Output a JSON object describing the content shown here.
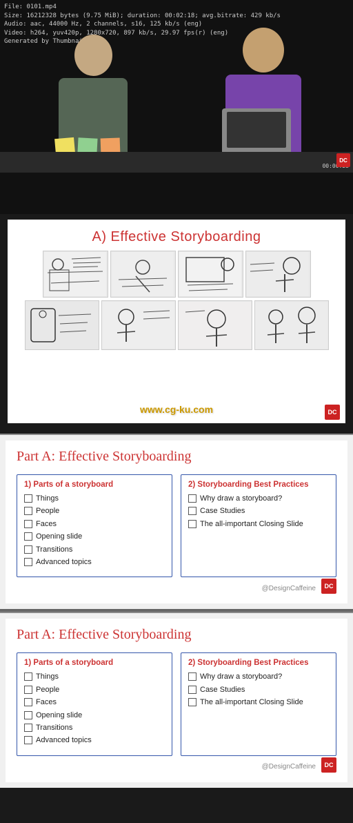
{
  "video": {
    "metadata_line1": "File: 0101.mp4",
    "metadata_line2": "Size: 16212328 bytes (9.75 MiB); duration: 00:02:18; avg.bitrate: 429 kb/s",
    "metadata_line3": "Audio: aac, 44000 Hz, 2 channels, s16, 125 kb/s (eng)",
    "metadata_line4": "Video: h264, yuv420p, 1280x720, 897 kb/s, 29.97 fps(r) (eng)",
    "metadata_line5": "Generated by Thumbnail me",
    "timestamp": "00:00:28",
    "apple_logo": ""
  },
  "slide1": {
    "title": "A) Effective Storyboarding",
    "watermark": "www.cg-ku.com",
    "dce_label": "DC"
  },
  "outline1": {
    "heading": "Part A: Effective Storyboarding",
    "col1_title": "1) Parts of a storyboard",
    "col1_items": [
      "Things",
      "People",
      "Faces",
      "Opening slide",
      "Transitions",
      "Advanced topics"
    ],
    "col2_title": "2) Storyboarding Best Practices",
    "col2_items": [
      "Why draw a storyboard?",
      "Case Studies",
      "The all-important Closing Slide"
    ],
    "attribution": "@DesignCaffeine",
    "dce_label": "DC"
  },
  "outline2": {
    "heading": "Part A: Effective Storyboarding",
    "col1_title": "1) Parts of a storyboard",
    "col1_items": [
      "Things",
      "People",
      "Faces",
      "Opening slide",
      "Transitions",
      "Advanced topics"
    ],
    "col2_title": "2) Storyboarding Best Practices",
    "col2_items": [
      "Why draw a storyboard?",
      "Case Studies",
      "The all-important Closing Slide"
    ],
    "attribution": "@DesignCaffeine",
    "dce_label": "DC"
  }
}
